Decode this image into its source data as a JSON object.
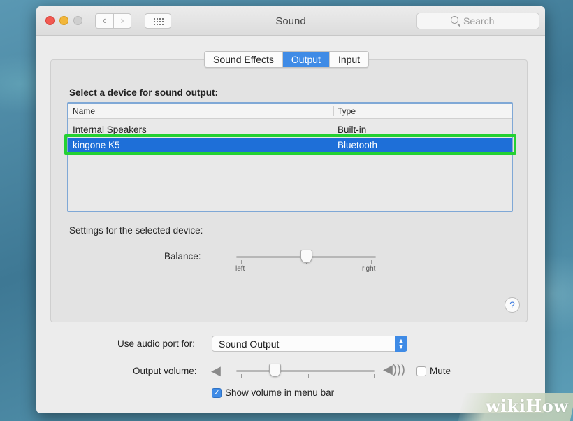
{
  "window": {
    "title": "Sound",
    "search_placeholder": "Search"
  },
  "tabs": [
    {
      "label": "Sound Effects",
      "active": false
    },
    {
      "label": "Output",
      "active": true
    },
    {
      "label": "Input",
      "active": false
    }
  ],
  "output": {
    "section_title": "Select a device for sound output:",
    "columns": [
      "Name",
      "Type"
    ],
    "devices": [
      {
        "name": "Internal Speakers",
        "type": "Built-in",
        "selected": false
      },
      {
        "name": "kingone K5",
        "type": "Bluetooth",
        "selected": true
      }
    ],
    "settings_label": "Settings for the selected device:",
    "balance_label": "Balance:",
    "balance_left": "left",
    "balance_right": "right",
    "balance_value": 0.5
  },
  "help_glyph": "?",
  "bottom": {
    "port_label": "Use audio port for:",
    "port_value": "Sound Output",
    "volume_label": "Output volume:",
    "volume_value": 0.28,
    "mute_label": "Mute",
    "mute_checked": false,
    "show_volume_label": "Show volume in menu bar",
    "show_volume_checked": true
  },
  "watermark": "wikiHow",
  "colors": {
    "accent": "#3f8be6",
    "selection": "#1e6fd8",
    "highlight_box": "#24d132"
  },
  "icons": [
    "search-icon",
    "back-arrow-icon",
    "forward-arrow-icon",
    "grid-icon",
    "speaker-low-icon",
    "speaker-high-icon",
    "help-icon",
    "checkmark-icon",
    "up-down-arrows-icon"
  ]
}
